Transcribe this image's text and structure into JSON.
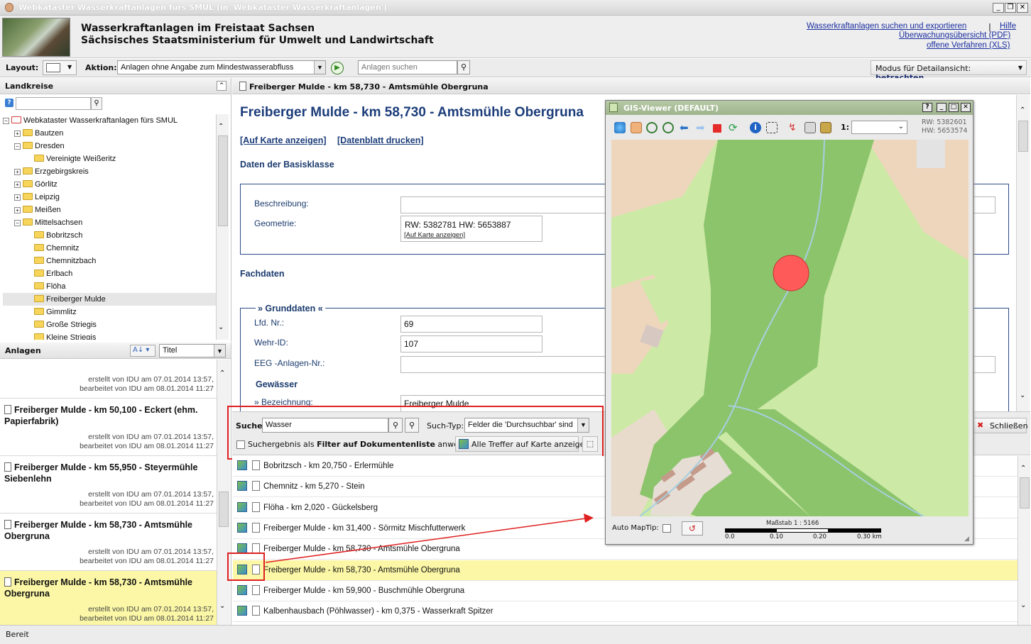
{
  "window": {
    "title": "Webkataster Wasserkraftanlagen fürs SMUL (in 'Webkataster Wasserkraftanlagen')"
  },
  "header": {
    "line1": "Wasserkraftanlagen im Freistaat Sachsen",
    "line2": "Sächsisches Staatsministerium für Umwelt und Landwirtschaft",
    "links": {
      "search_export": "Wasserkraftanlagen suchen und exportieren",
      "sep": "|",
      "help": "Hilfe",
      "overview_pdf": "Überwachungsübersicht (PDF)",
      "open_xls": "offene Verfahren (XLS)"
    }
  },
  "toolbar": {
    "layout_label": "Layout:",
    "action_label": "Aktion:",
    "action_value": "Anlagen ohne Angabe zum Mindestwasserabfluss",
    "search_placeholder": "Anlagen suchen",
    "mode_label": "Modus für Detailansicht:",
    "mode_value": "betrachten"
  },
  "landkreise": {
    "title": "Landkreise",
    "tree": [
      {
        "label": "Webkataster Wasserkraftanlagen fürs SMUL",
        "level": 0,
        "toggle": "−",
        "root": true
      },
      {
        "label": "Bautzen",
        "level": 1,
        "toggle": "+"
      },
      {
        "label": "Dresden",
        "level": 1,
        "toggle": "−"
      },
      {
        "label": "Vereinigte Weißeritz",
        "level": 2,
        "toggle": ""
      },
      {
        "label": "Erzgebirgskreis",
        "level": 1,
        "toggle": "+"
      },
      {
        "label": "Görlitz",
        "level": 1,
        "toggle": "+"
      },
      {
        "label": "Leipzig",
        "level": 1,
        "toggle": "+"
      },
      {
        "label": "Meißen",
        "level": 1,
        "toggle": "+"
      },
      {
        "label": "Mittelsachsen",
        "level": 1,
        "toggle": "−"
      },
      {
        "label": "Bobritzsch",
        "level": 2,
        "toggle": ""
      },
      {
        "label": "Chemnitz",
        "level": 2,
        "toggle": ""
      },
      {
        "label": "Chemnitzbach",
        "level": 2,
        "toggle": ""
      },
      {
        "label": "Erlbach",
        "level": 2,
        "toggle": ""
      },
      {
        "label": "Flöha",
        "level": 2,
        "toggle": ""
      },
      {
        "label": "Freiberger Mulde",
        "level": 2,
        "toggle": "",
        "selected": true
      },
      {
        "label": "Gimmlitz",
        "level": 2,
        "toggle": ""
      },
      {
        "label": "Große Striegis",
        "level": 2,
        "toggle": ""
      },
      {
        "label": "Kleine Striegis",
        "level": 2,
        "toggle": ""
      }
    ]
  },
  "anlagen": {
    "title": "Anlagen",
    "sort_value": "Titel",
    "cards": [
      {
        "title": "",
        "created": "erstellt von IDU am 07.01.2014 13:57,",
        "edited": "bearbeitet von IDU am 08.01.2014 11:27"
      },
      {
        "title": "Freiberger Mulde - km 50,100 - Eckert (ehm. Papierfabrik)",
        "created": "erstellt von IDU am 07.01.2014 13:57,",
        "edited": "bearbeitet von IDU am 08.01.2014 11:27"
      },
      {
        "title": "Freiberger Mulde - km 55,950 - Steyermühle Siebenlehn",
        "created": "erstellt von IDU am 07.01.2014 13:57,",
        "edited": "bearbeitet von IDU am 08.01.2014 11:27"
      },
      {
        "title": "Freiberger Mulde - km 58,730 - Amtsmühle Obergruna",
        "created": "erstellt von IDU am 07.01.2014 13:57,",
        "edited": "bearbeitet von IDU am 08.01.2014 11:27"
      },
      {
        "title": "Freiberger Mulde - km 58,730 - Amtsmühle Obergruna",
        "created": "erstellt von IDU am 07.01.2014 13:57,",
        "edited": "bearbeitet von IDU am 08.01.2014 11:27",
        "selected": true
      }
    ]
  },
  "detail": {
    "tab_title": "Freiberger Mulde - km 58,730 - Amtsmühle Obergruna",
    "heading": "Freiberger Mulde - km 58,730 - Amtsmühle Obergruna",
    "link_map": "[Auf Karte anzeigen]",
    "link_print": "[Datenblatt drucken]",
    "basis_title": "Daten der Basisklasse",
    "beschreibung_label": "Beschreibung:",
    "geometrie_label": "Geometrie:",
    "geometrie_value": "RW: 5382781  HW: 5653887",
    "geometrie_link": "[Auf Karte anzeigen]",
    "fachdaten_title": "Fachdaten",
    "grunddaten_title": "» Grunddaten «",
    "lfd_label": "Lfd. Nr.:",
    "lfd_value": "69",
    "wehr_label": "Wehr-ID:",
    "wehr_value": "107",
    "eeg_label": "EEG -Anlagen-Nr.:",
    "gewaesser_title": "Gewässer",
    "bezeichnung_label": "» Bezeichnung:",
    "bezeichnung_value": "Freiberger Mulde",
    "close_label": "Schließen"
  },
  "search": {
    "label": "Suche",
    "value": "Wasser",
    "type_label": "Such-Typ:",
    "type_value": "Felder die 'Durchsuchbar' sind",
    "filter_label": "Suchergebnis als ",
    "filter_bold": "Filter auf Dokumentenliste",
    "filter_tail": " anwenden",
    "show_all_label": "Alle Treffer auf Karte anzeigen"
  },
  "results": [
    {
      "text": "Bobritzsch - km 20,750 - Erlermühle"
    },
    {
      "text": "Chemnitz - km 5,270 - Stein"
    },
    {
      "text": "Flöha - km 2,020 - Gückelsberg"
    },
    {
      "text": "Freiberger Mulde - km 31,400 - Sörmitz Mischfutterwerk"
    },
    {
      "text": "Freiberger Mulde - km 58,730 - Amtsmühle Obergruna"
    },
    {
      "text": "Freiberger Mulde - km 58,730 - Amtsmühle Obergruna",
      "selected": true
    },
    {
      "text": "Freiberger Mulde - km 59,900 - Buschmühle Obergruna"
    },
    {
      "text": "Kalbenhausbach (Pöhlwasser) - km 0,375 - Wasserkraft Spitzer"
    }
  ],
  "gis": {
    "title": "GIS-Viewer (DEFAULT)",
    "scale_prefix": "1:",
    "rw": "RW: 5382601",
    "hw": "HW: 5653574",
    "maptip_label": "Auto MapTip:",
    "scale_text": "Maßstab 1 : 5166",
    "scale_ticks": [
      "0.0",
      "0.10",
      "0.20",
      "0.30 km"
    ]
  },
  "status": {
    "text": "Bereit"
  },
  "colors": {
    "highlight": "#fbf7a6",
    "accent_red": "#e02020",
    "link": "#1a2ea0",
    "map_dark": "#8cc46c",
    "map_light": "#cde9a6"
  }
}
